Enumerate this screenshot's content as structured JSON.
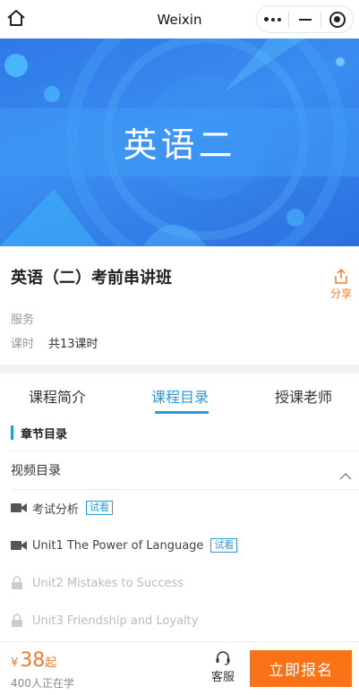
{
  "titlebar": {
    "title": "Weixin"
  },
  "banner": {
    "text": "英语二"
  },
  "course": {
    "title": "英语（二）考前串讲班",
    "share_label": "分享",
    "service_label": "服务",
    "hours_label": "课时",
    "hours_value": "共13课时"
  },
  "tabs": [
    {
      "label": "课程简介",
      "active": false
    },
    {
      "label": "课程目录",
      "active": true
    },
    {
      "label": "授课老师",
      "active": false
    }
  ],
  "catalog": {
    "section_title": "章节目录",
    "video_dir_label": "视频目录",
    "lessons": [
      {
        "name": "考试分析",
        "trial_label": "试看",
        "locked": false
      },
      {
        "name": "Unit1 The Power of Language",
        "trial_label": "试看",
        "locked": false
      },
      {
        "name": "Unit2 Mistakes to Success",
        "locked": true
      },
      {
        "name": "Unit3 Friendship and Loyalty",
        "locked": true
      }
    ]
  },
  "bottom": {
    "currency": "¥",
    "price": "38",
    "price_suffix": "起",
    "learners": "400人正在学",
    "service_label": "客服",
    "enroll_label": "立即报名"
  },
  "colors": {
    "accent": "#2a9ad8",
    "orange": "#f97216",
    "banner": "#3a8df0"
  }
}
